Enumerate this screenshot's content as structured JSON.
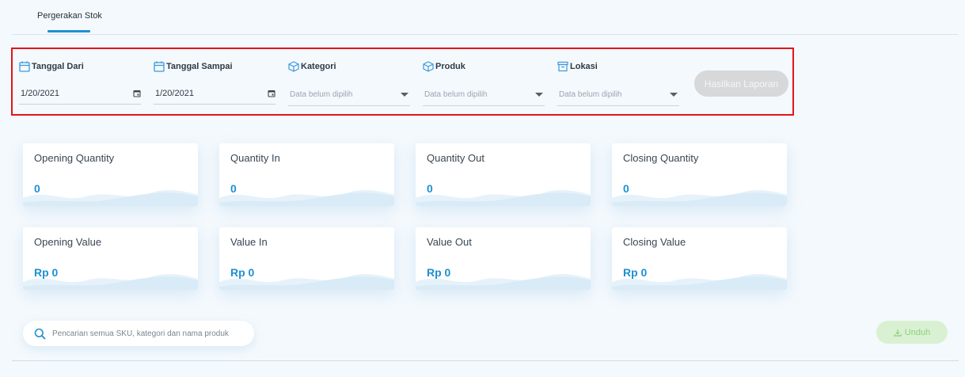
{
  "tabs": [
    {
      "label": "Pergerakan Stok",
      "active": true
    }
  ],
  "filters": {
    "date_from": {
      "label": "Tanggal Dari",
      "value": "1/20/2021",
      "icon": "calendar-icon"
    },
    "date_to": {
      "label": "Tanggal Sampai",
      "value": "1/20/2021",
      "icon": "calendar-icon"
    },
    "category": {
      "label": "Kategori",
      "placeholder": "Data belum dipilih",
      "icon": "box-icon"
    },
    "product": {
      "label": "Produk",
      "placeholder": "Data belum dipilih",
      "icon": "box-icon"
    },
    "location": {
      "label": "Lokasi",
      "placeholder": "Data belum dipilih",
      "icon": "warehouse-icon"
    },
    "generate_label": "Hasilkan Laporan"
  },
  "cards": [
    {
      "title": "Opening Quantity",
      "value": "0"
    },
    {
      "title": "Quantity In",
      "value": "0"
    },
    {
      "title": "Quantity Out",
      "value": "0"
    },
    {
      "title": "Closing Quantity",
      "value": "0"
    },
    {
      "title": "Opening Value",
      "value": "Rp 0"
    },
    {
      "title": "Value In",
      "value": "Rp 0"
    },
    {
      "title": "Value Out",
      "value": "Rp 0"
    },
    {
      "title": "Closing Value",
      "value": "Rp 0"
    }
  ],
  "search": {
    "placeholder": "Pencarian semua SKU, kategori dan nama produk"
  },
  "download_label": "Unduh",
  "colors": {
    "accent": "#1e90d1",
    "highlight_border": "#e3151a",
    "download_green": "#8fd07e"
  }
}
